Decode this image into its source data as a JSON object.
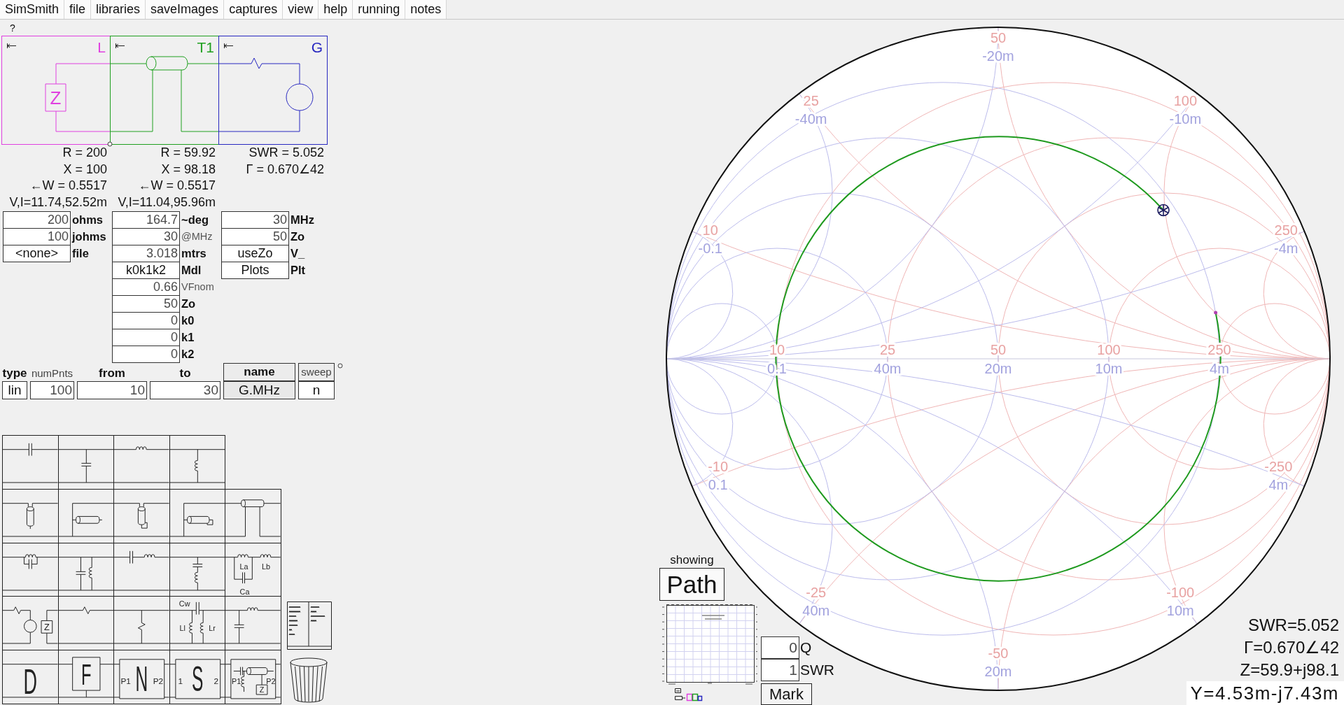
{
  "menu": [
    "SimSmith",
    "file",
    "libraries",
    "saveImages",
    "captures",
    "view",
    "help",
    "running",
    "notes"
  ],
  "help_mark": "?",
  "circuit": {
    "blocks": [
      {
        "kind": "load",
        "label": "L",
        "color": "#e040e0",
        "symbol": "Z",
        "readings": [
          "R = 200",
          "X = 100",
          "←W = 0.5517",
          "V,I=11.74,52.52m"
        ],
        "fields": [
          {
            "kind": "field",
            "value": "200",
            "unit": "ohms",
            "dimmed": false
          },
          {
            "kind": "field",
            "value": "100",
            "unit": "johms",
            "dimmed": false
          },
          {
            "kind": "button",
            "value": "<none>",
            "unit": "file",
            "dimmed": false
          }
        ]
      },
      {
        "kind": "line",
        "label": "T1",
        "color": "#20a020",
        "readings": [
          "R = 59.92",
          "X = 98.18",
          "←W = 0.5517",
          "V,I=11.04,95.96m"
        ],
        "fields": [
          {
            "kind": "field",
            "value": "164.7",
            "unit": "~deg",
            "dimmed": false
          },
          {
            "kind": "field",
            "value": "30",
            "unit": "@MHz",
            "dimmed": true
          },
          {
            "kind": "field",
            "value": "3.018",
            "unit": "mtrs",
            "dimmed": false
          },
          {
            "kind": "button",
            "value": "k0k1k2",
            "unit": "Mdl",
            "dimmed": false
          },
          {
            "kind": "field",
            "value": "0.66",
            "unit": "VFnom",
            "dimmed": true
          },
          {
            "kind": "field",
            "value": "50",
            "unit": "Zo",
            "dimmed": false
          },
          {
            "kind": "field",
            "value": "0",
            "unit": "k0",
            "dimmed": false
          },
          {
            "kind": "field",
            "value": "0",
            "unit": "k1",
            "dimmed": false
          },
          {
            "kind": "field",
            "value": "0",
            "unit": "k2",
            "dimmed": false
          }
        ]
      },
      {
        "kind": "generator",
        "label": "G",
        "color": "#2828c0",
        "readings": [
          "SWR = 5.052",
          "Γ = 0.670∠42"
        ],
        "fields": [
          {
            "kind": "field",
            "value": "30",
            "unit": "MHz",
            "dimmed": false
          },
          {
            "kind": "field",
            "value": "50",
            "unit": "Zo",
            "dimmed": false
          },
          {
            "kind": "button",
            "value": "useZo",
            "unit": "V_",
            "dimmed": false
          },
          {
            "kind": "button",
            "value": "Plots",
            "unit": "Plt",
            "dimmed": false
          }
        ]
      }
    ]
  },
  "sweep": [
    {
      "kind": "button",
      "label": "type",
      "value": "lin",
      "dimmed": false,
      "boxed": false
    },
    {
      "kind": "field",
      "label": "numPnts",
      "value": "100",
      "dimmed": true,
      "boxed": false
    },
    {
      "kind": "field",
      "label": "from",
      "value": "10",
      "dimmed": false,
      "boxed": false
    },
    {
      "kind": "field",
      "label": "to",
      "value": "30",
      "dimmed": false,
      "boxed": false
    },
    {
      "kind": "selector",
      "label": "name",
      "value": "G.MHz",
      "dimmed": false,
      "boxed": true
    },
    {
      "kind": "button",
      "label": "sweep",
      "value": "n",
      "dimmed": true,
      "boxed": true
    }
  ],
  "palette": {
    "rows": [
      [
        {
          "kind": "series-capacitor"
        },
        {
          "kind": "shunt-capacitor"
        },
        {
          "kind": "series-inductor"
        },
        {
          "kind": "shunt-inductor"
        }
      ],
      [
        {
          "kind": "shunt-open-stub"
        },
        {
          "kind": "series-open-stub"
        },
        {
          "kind": "shunt-shorted-stub"
        },
        {
          "kind": "series-shorted-stub"
        },
        {
          "kind": "transmission-line"
        }
      ],
      [
        {
          "kind": "parallel-lc"
        },
        {
          "kind": "shunt-parallel-lc"
        },
        {
          "kind": "series-lc"
        },
        {
          "kind": "shunt-series-lc"
        },
        {
          "kind": "coupled-coils",
          "labels": [
            "La",
            "Lb",
            "Ca"
          ]
        }
      ],
      [
        {
          "kind": "generator-load",
          "labels": [
            "Z"
          ]
        },
        {
          "kind": "series-resistor"
        },
        {
          "kind": "shunt-resistor"
        },
        {
          "kind": "crystal",
          "labels": [
            "Cw",
            "Ll",
            "Lr"
          ]
        },
        {
          "kind": "l-network"
        }
      ],
      [
        {
          "kind": "data-block",
          "labels": [
            "D"
          ]
        },
        {
          "kind": "function-block",
          "labels": [
            "F"
          ]
        },
        {
          "kind": "network-block",
          "labels": [
            "P1",
            "N",
            "P2"
          ]
        },
        {
          "kind": "s-parameter-block",
          "labels": [
            "1",
            "S",
            "2"
          ]
        },
        {
          "kind": "custom-block",
          "labels": [
            "P1",
            "P2",
            "Z"
          ]
        }
      ]
    ]
  },
  "smith_chart": {
    "positive_reactance": [
      {
        "impedance": "10",
        "admittance": "-0.1"
      },
      {
        "impedance": "25",
        "admittance": "-40m"
      },
      {
        "impedance": "50",
        "admittance": "-20m"
      },
      {
        "impedance": "100",
        "admittance": "-10m"
      },
      {
        "impedance": "250",
        "admittance": "-4m"
      }
    ],
    "resistance": [
      {
        "impedance": "10",
        "admittance": "0.1"
      },
      {
        "impedance": "25",
        "admittance": "40m"
      },
      {
        "impedance": "50",
        "admittance": "20m"
      },
      {
        "impedance": "100",
        "admittance": "10m"
      },
      {
        "impedance": "250",
        "admittance": "4m"
      }
    ],
    "negative_reactance": [
      {
        "impedance": "-10",
        "admittance": "0.1"
      },
      {
        "impedance": "-25",
        "admittance": "40m"
      },
      {
        "impedance": "-50",
        "admittance": "20m"
      },
      {
        "impedance": "-100",
        "admittance": "10m"
      },
      {
        "impedance": "-250",
        "admittance": "4m"
      }
    ]
  },
  "display": {
    "label": "showing",
    "mode": "Path"
  },
  "markers": [
    {
      "value": "0",
      "suffix": "Q"
    },
    {
      "value": "1",
      "suffix": "SWR"
    }
  ],
  "mark_button": "Mark",
  "readouts": [
    {
      "text": "SWR=5.052",
      "highlighted": false
    },
    {
      "text": "Γ=0.670∠42",
      "highlighted": false
    },
    {
      "text": "Z=59.9+j98.1",
      "highlighted": false
    },
    {
      "text": "Y=4.53m-j7.43m",
      "highlighted": true
    }
  ]
}
